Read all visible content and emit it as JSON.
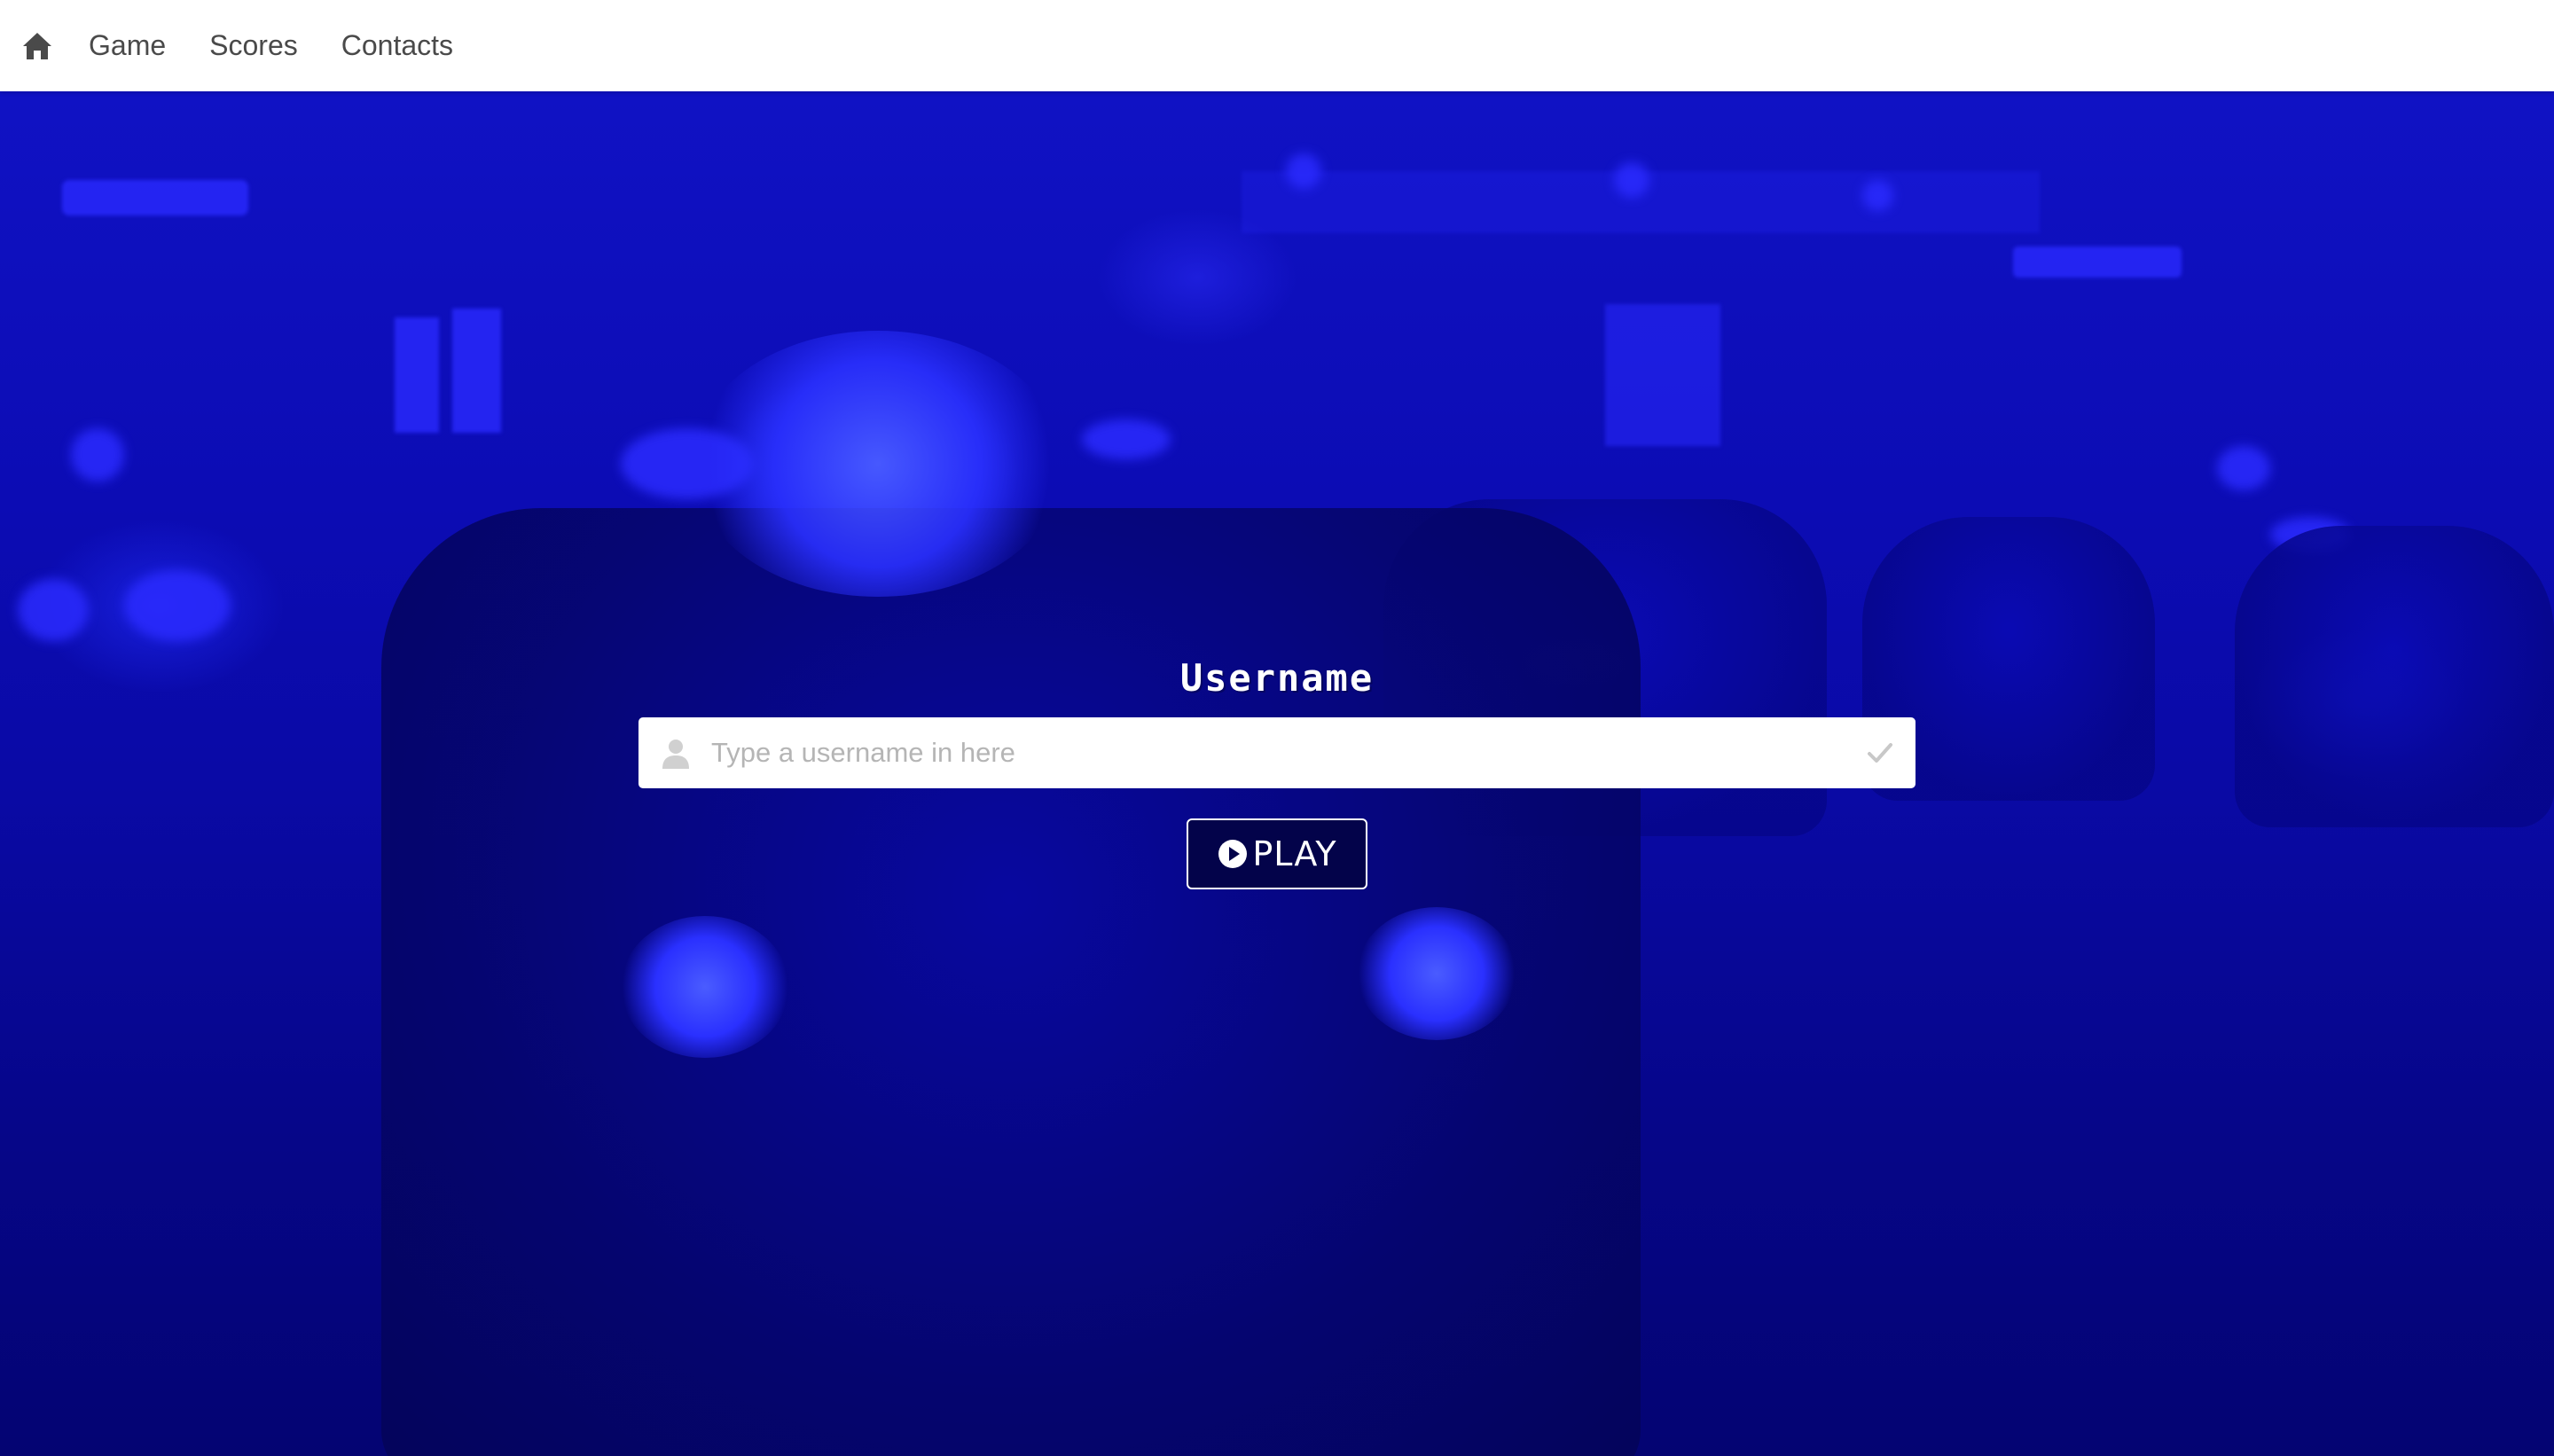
{
  "nav": {
    "home_icon": "home-icon",
    "items": [
      {
        "label": "Game"
      },
      {
        "label": "Scores"
      },
      {
        "label": "Contacts"
      }
    ]
  },
  "form": {
    "title": "Username",
    "username_placeholder": "Type a username in here",
    "username_value": "",
    "user_icon": "user-icon",
    "check_icon": "check-icon",
    "play_icon": "play-circle-icon",
    "play_label": "PLAY"
  },
  "colors": {
    "navbar_bg": "#ffffff",
    "nav_text": "#4a4a4a",
    "background_tint": "#0a0aa6",
    "button_bg": "#03034a"
  }
}
